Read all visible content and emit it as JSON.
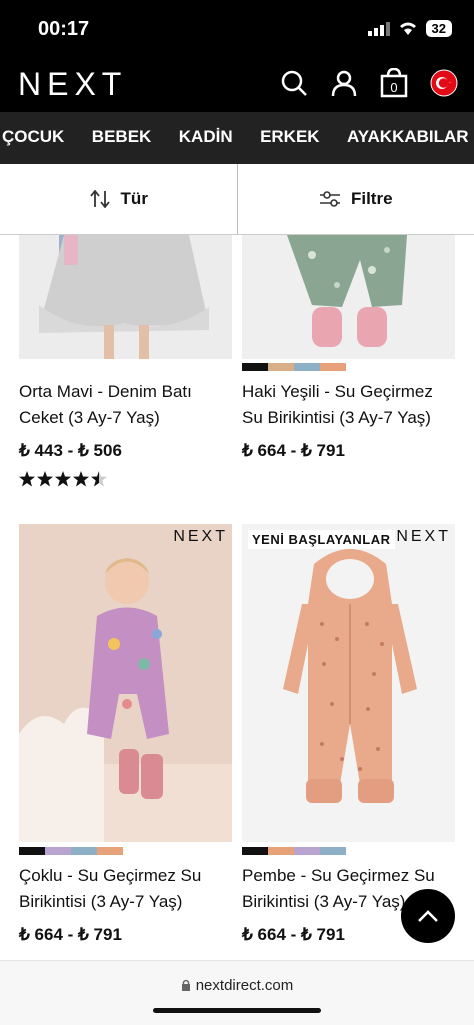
{
  "status": {
    "time": "00:17",
    "battery": "32"
  },
  "header": {
    "logo": "NEXT",
    "bag_count": "0"
  },
  "categories": [
    "ÇOCUK",
    "BEBEK",
    "KADİN",
    "ERKEK",
    "AYAKKABILAR",
    "I"
  ],
  "sortbar": {
    "sort_label": "Tür",
    "filter_label": "Filtre"
  },
  "products": [
    {
      "name_line1": "Orta Mavi - Denim Batı",
      "name_line2": "Ceket (3 Ay-7 Yaş)",
      "price": "₺ 443 - ₺ 506",
      "rating": 4.5
    },
    {
      "name_line1": "Haki Yeşili - Su Geçirmez",
      "name_line2": "Su Birikintisi (3 Ay-7 Yaş)",
      "price": "₺ 664 - ₺ 791"
    },
    {
      "name_line1": "Çoklu - Su Geçirmez Su",
      "name_line2": "Birikintisi (3 Ay-7 Yaş)",
      "price": "₺ 664 - ₺ 791",
      "brand": "NEXT"
    },
    {
      "name_line1": "Pembe - Su Geçirmez Su",
      "name_line2": "Birikintisi (3 Ay-7 Yaş)",
      "price": "₺ 664 - ₺ 791",
      "brand": "NEXT",
      "badge": "YENİ BAŞLAYANLAR"
    }
  ],
  "footer": {
    "url": "nextdirect.com"
  },
  "colors": {
    "header_bg": "#000000",
    "nav_bg": "#222222",
    "accent_red": "#e30a17"
  }
}
